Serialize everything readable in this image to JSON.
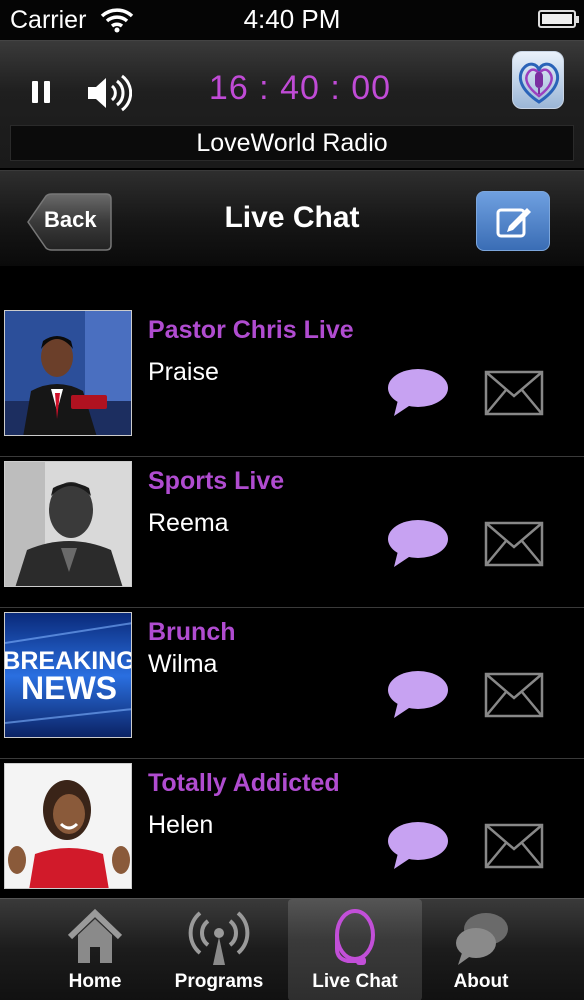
{
  "status_bar": {
    "carrier": "Carrier",
    "time": "4:40 PM"
  },
  "player": {
    "timer": "16 : 40 : 00",
    "station": "LoveWorld Radio"
  },
  "nav": {
    "back_label": "Back",
    "title": "Live Chat"
  },
  "chats": [
    {
      "title": "Pastor Chris Live",
      "user": "Praise",
      "thumb": "man-in-suit-photo"
    },
    {
      "title": "Sports Live",
      "user": "Reema",
      "thumb": "man-portrait-photo"
    },
    {
      "title": "Brunch",
      "user": "Wilma",
      "thumb": "breaking-news-graphic",
      "thumb_text_1": "BREAKING",
      "thumb_text_2": "NEWS"
    },
    {
      "title": "Totally Addicted",
      "user": "Helen",
      "thumb": "woman-in-red-photo"
    }
  ],
  "tabs": [
    {
      "label": "Home",
      "icon": "home-icon"
    },
    {
      "label": "Programs",
      "icon": "broadcast-icon"
    },
    {
      "label": "Live Chat",
      "icon": "headset-icon",
      "active": true
    },
    {
      "label": "About",
      "icon": "speech-bubbles-icon"
    }
  ],
  "colors": {
    "accent_purple": "#b04cd0",
    "timer_magenta": "#c04bd6",
    "chat_bubble": "#c7a2f2",
    "compose_blue": "#4a7fc6"
  }
}
